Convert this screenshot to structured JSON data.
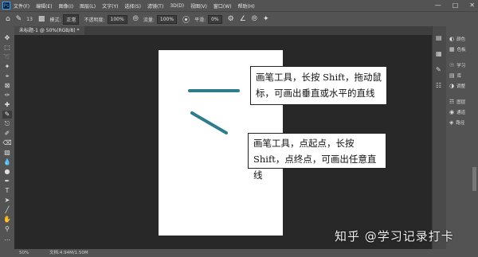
{
  "menubar": {
    "app_logo": "Ps",
    "items": [
      "文件(F)",
      "编辑(E)",
      "图像(I)",
      "图层(L)",
      "文字(Y)",
      "选择(S)",
      "滤镜(T)",
      "3D(D)",
      "视图(V)",
      "窗口(W)",
      "帮助(H)"
    ]
  },
  "options": {
    "mode_label": "模式:",
    "mode_value": "正常",
    "opacity_label": "不透明度:",
    "opacity_value": "100%",
    "flow_label": "流量:",
    "flow_value": "100%",
    "smooth_label": "平滑:",
    "smooth_value": "0%",
    "brush_size": "13"
  },
  "document": {
    "tab_title": "未标题-1 @ 50%(RGB/8) *"
  },
  "annotations": {
    "callout1": "画笔工具，长按 Shift，拖动鼠标，可画出垂直或水平的直线",
    "callout2": "画笔工具，点起点，长按 Shift，点终点，可画出任意直线"
  },
  "panels": {
    "items": [
      "颜色",
      "色板",
      "学习",
      "库",
      "调整",
      "图层",
      "通道",
      "路径"
    ]
  },
  "statusbar": {
    "zoom": "50%",
    "docinfo": "文档:4.94M/1.50M"
  },
  "watermark": "知乎 @学习记录打卡",
  "colors": {
    "stroke": "#2e7d8c",
    "ps_blue": "#31a8ff"
  }
}
